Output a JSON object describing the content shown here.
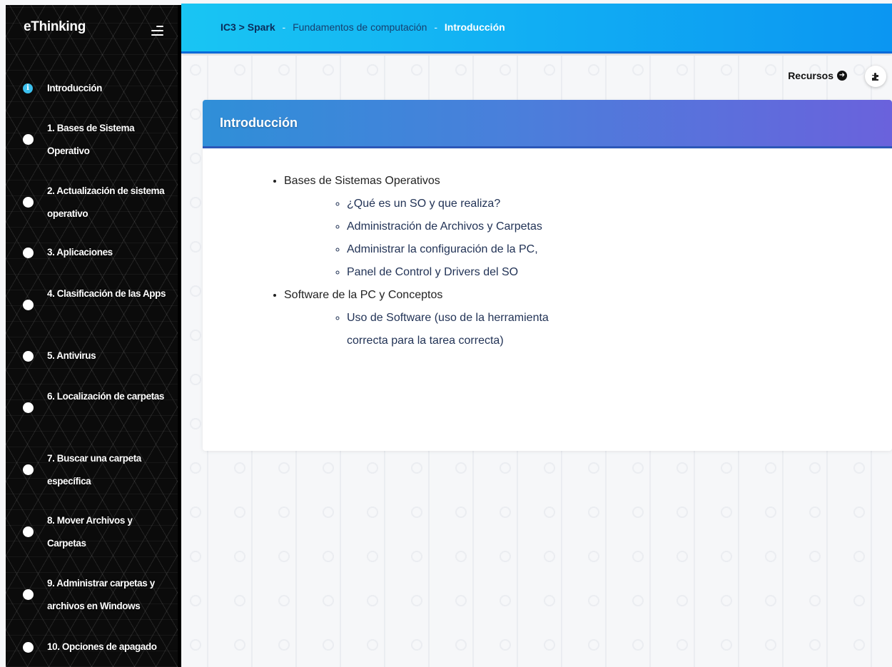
{
  "sidebar": {
    "brand": "eThinking",
    "toggle_icon": "menu-icon",
    "items": [
      {
        "label": "Introducción",
        "icon": "info-icon",
        "active": true
      },
      {
        "label": "1. Bases de Sistema Operativo",
        "icon": "dot"
      },
      {
        "label": "2. Actualización de sistema operativo",
        "icon": "dot"
      },
      {
        "label": "3. Aplicaciones",
        "icon": "dot"
      },
      {
        "label": "4. Clasificación de las Apps",
        "icon": "dot"
      },
      {
        "label": "5. Antivirus",
        "icon": "dot"
      },
      {
        "label": "6. Localización de carpetas",
        "icon": "dot"
      },
      {
        "label": "7. Buscar una carpeta específica",
        "icon": "dot"
      },
      {
        "label": "8. Mover Archivos y Carpetas",
        "icon": "dot"
      },
      {
        "label": "9. Administrar carpetas y archivos en Windows",
        "icon": "dot"
      },
      {
        "label": "10. Opciones de apagado",
        "icon": "dot"
      }
    ]
  },
  "header": {
    "breadcrumb": {
      "root": "IC3 > Spark",
      "separator": "-",
      "course": "Fundamentos de computación",
      "current": "Introducción"
    }
  },
  "toolbar": {
    "recursos_label": "Recursos",
    "recursos_icon": "arrow-circle-right-icon",
    "extension_icon": "puzzle-icon"
  },
  "content": {
    "title": "Introducción",
    "sections": [
      {
        "title": "Bases de Sistemas Operativos",
        "items": [
          "¿Qué es un SO y que realiza?",
          "Administración de Archivos y Carpetas",
          "Administrar la configuración de la PC,",
          "Panel de Control y Drivers del SO"
        ]
      },
      {
        "title": "Software de la PC y Conceptos",
        "items": [
          "Uso de Software (uso de la herramienta correcta para la tarea correcta)"
        ]
      }
    ]
  },
  "colors": {
    "header_start": "#19c5f3",
    "header_end": "#0b96f2",
    "card_header_start": "#2f8fd8",
    "card_header_end": "#6a62dc",
    "info_icon": "#3cc0ee",
    "sidebar_bg": "#0b0b0b"
  }
}
